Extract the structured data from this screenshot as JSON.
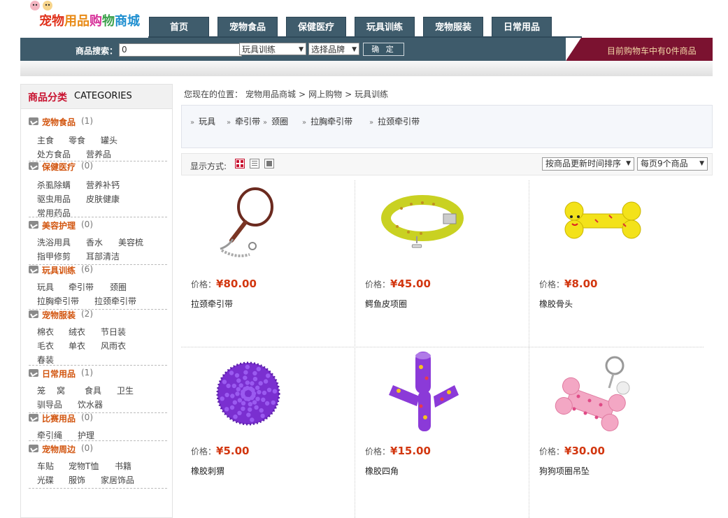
{
  "brand": {
    "logo_text": "宠物用品购物商城"
  },
  "nav": {
    "tabs": [
      "首页",
      "宠物食品",
      "保健医疗",
      "玩具训练",
      "宠物服装",
      "日常用品"
    ]
  },
  "search": {
    "label": "商品搜索：",
    "value": "0",
    "category_select": "玩具训练",
    "brand_select": "选择品牌",
    "submit": "确 定"
  },
  "cart": {
    "text": "目前购物车中有0件商品"
  },
  "sidebar": {
    "title_cn": "商品分类",
    "title_en": "CATEGORIES",
    "categories": [
      {
        "name": "宠物食品",
        "count": "(1)",
        "items": [
          "主食",
          "零食",
          "罐头",
          "处方食品",
          "营养品"
        ]
      },
      {
        "name": "保健医疗",
        "count": "(0)",
        "items": [
          "杀虱除螨",
          "营养补钙",
          "驱虫用品",
          "皮肤健康",
          "常用药品"
        ]
      },
      {
        "name": "美容护理",
        "count": "(0)",
        "items": [
          "洗浴用具",
          "香水",
          "美容梳",
          "指甲修剪",
          "耳部清洁"
        ]
      },
      {
        "name": "玩具训练",
        "count": "(6)",
        "items": [
          "玩具",
          "牵引带",
          "颈圈",
          "拉胸牵引带",
          "拉颈牵引带"
        ]
      },
      {
        "name": "宠物服装",
        "count": "(2)",
        "items": [
          "棉衣",
          "绒衣",
          "节日装",
          "毛衣",
          "单衣",
          "风雨衣",
          "春装"
        ]
      },
      {
        "name": "日常用品",
        "count": "(1)",
        "items": [
          "笼",
          "窝",
          "食具",
          "卫生",
          "驯导品",
          "饮水器"
        ]
      },
      {
        "name": "比赛用品",
        "count": "(0)",
        "items": [
          "牵引绳",
          "护理"
        ]
      },
      {
        "name": "宠物周边",
        "count": "(0)",
        "items": [
          "车贴",
          "宠物T恤",
          "书籍",
          "光碟",
          "服饰",
          "家居饰品"
        ]
      }
    ]
  },
  "breadcrumb": {
    "prefix": "您现在的位置：",
    "items": [
      "宠物用品商城",
      ">",
      "网上购物",
      ">",
      "玩具训练"
    ]
  },
  "tags": [
    "玩具",
    "牵引带",
    "颈圈",
    "拉胸牵引带",
    "拉颈牵引带"
  ],
  "view": {
    "label": "显示方式:",
    "sort": "按商品更新时间排序",
    "per_page": "每页9个商品"
  },
  "price_label": "价格：",
  "products": [
    {
      "price": "¥80.00",
      "name": "拉颈牵引带"
    },
    {
      "price": "¥45.00",
      "name": "鳄鱼皮项圈"
    },
    {
      "price": "¥8.00",
      "name": "橡胶骨头"
    },
    {
      "price": "¥5.00",
      "name": "橡胶刺猬"
    },
    {
      "price": "¥15.00",
      "name": "橡胶四角"
    },
    {
      "price": "¥30.00",
      "name": "狗狗项圈吊坠"
    }
  ]
}
